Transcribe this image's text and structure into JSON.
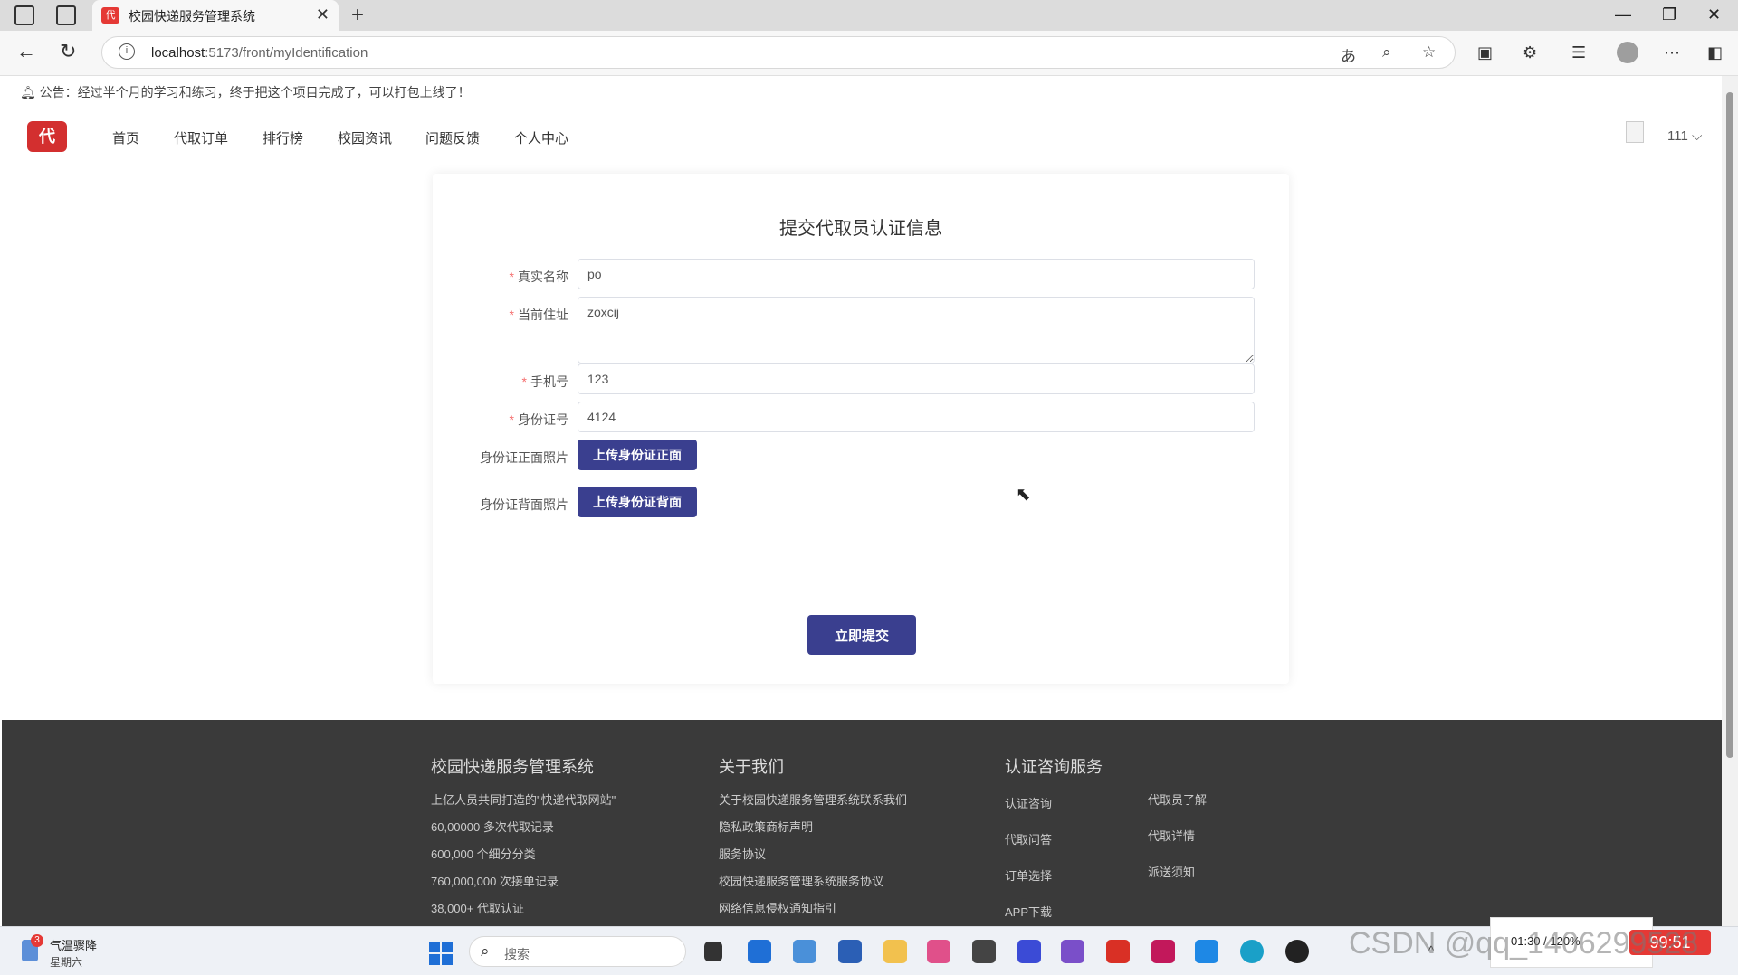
{
  "browser": {
    "tab_title": "校园快递服务管理系统",
    "url_host": "localhost",
    "url_path": ":5173/front/myIdentification"
  },
  "notice": "公告：经过半个月的学习和练习，终于把这个项目完成了，可以打包上线了！",
  "nav": {
    "logo_text": "代",
    "items": [
      "首页",
      "代取订单",
      "排行榜",
      "校园资讯",
      "问题反馈",
      "个人中心"
    ],
    "username": "111"
  },
  "form": {
    "title": "提交代取员认证信息",
    "name_label": "真实名称",
    "name_value": "po",
    "address_label": "当前住址",
    "address_value": "zoxcij",
    "phone_label": "手机号",
    "phone_value": "123",
    "idcard_label": "身份证号",
    "idcard_value": "4124",
    "front_label": "身份证正面照片",
    "front_button": "上传身份证正面",
    "back_label": "身份证背面照片",
    "back_button": "上传身份证背面",
    "submit_button": "立即提交"
  },
  "footer": {
    "col1": {
      "title": "校园快递服务管理系统",
      "items": [
        "上亿人员共同打造的\"快递代取网站\"",
        "60,00000 多次代取记录",
        "600,000 个细分分类",
        "760,000,000 次接单记录",
        "38,000+ 代取认证"
      ]
    },
    "col2": {
      "title": "关于我们",
      "items": [
        "关于校园快递服务管理系统联系我们",
        "隐私政策商标声明",
        "服务协议",
        "校园快递服务管理系统服务协议",
        "网络信息侵权通知指引"
      ]
    },
    "col3": {
      "title": "认证咨询服务",
      "items_left": [
        "认证咨询",
        "代取问答",
        "订单选择",
        "APP下载"
      ],
      "items_right": [
        "代取员了解",
        "代取详情",
        "派送须知"
      ]
    }
  },
  "taskbar": {
    "weather_title": "气温骤降",
    "weather_sub": "星期六",
    "weather_badge": "3",
    "search_placeholder": "搜索",
    "clock": "01:30 / 120%",
    "watermark": "CSDN @qq_1406299528",
    "record_badge": "99:51"
  }
}
